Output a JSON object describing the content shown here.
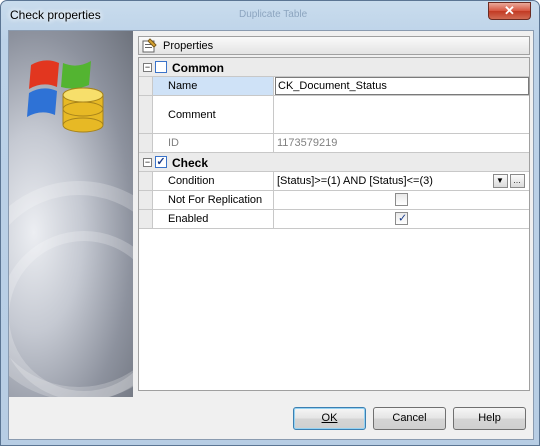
{
  "window": {
    "title": "Check properties",
    "close_glyph": "✕",
    "background_text": "Duplicate Table"
  },
  "properties_header": {
    "label": "Properties",
    "icon": "properties-icon"
  },
  "categories": [
    {
      "label": "Common",
      "toggle": "⊟",
      "checked": false
    },
    {
      "label": "Check",
      "toggle": "⊟",
      "checked": true
    }
  ],
  "common_rows": [
    {
      "name": "Name",
      "value": "CK_Document_Status"
    },
    {
      "name": "Comment",
      "value": ""
    },
    {
      "name": "ID",
      "value": "1173579219"
    }
  ],
  "check_rows": [
    {
      "name": "Condition",
      "value": "[Status]>=(1) AND [Status]<=(3)"
    },
    {
      "name": "Not For Replication",
      "checked": false
    },
    {
      "name": "Enabled",
      "checked": true
    }
  ],
  "buttons": {
    "ok": "OK",
    "cancel": "Cancel",
    "help": "Help"
  },
  "colors": {
    "accent_selection": "#cfe2f7",
    "window_frame": "#b7cde4",
    "close_button": "#c23a23"
  }
}
